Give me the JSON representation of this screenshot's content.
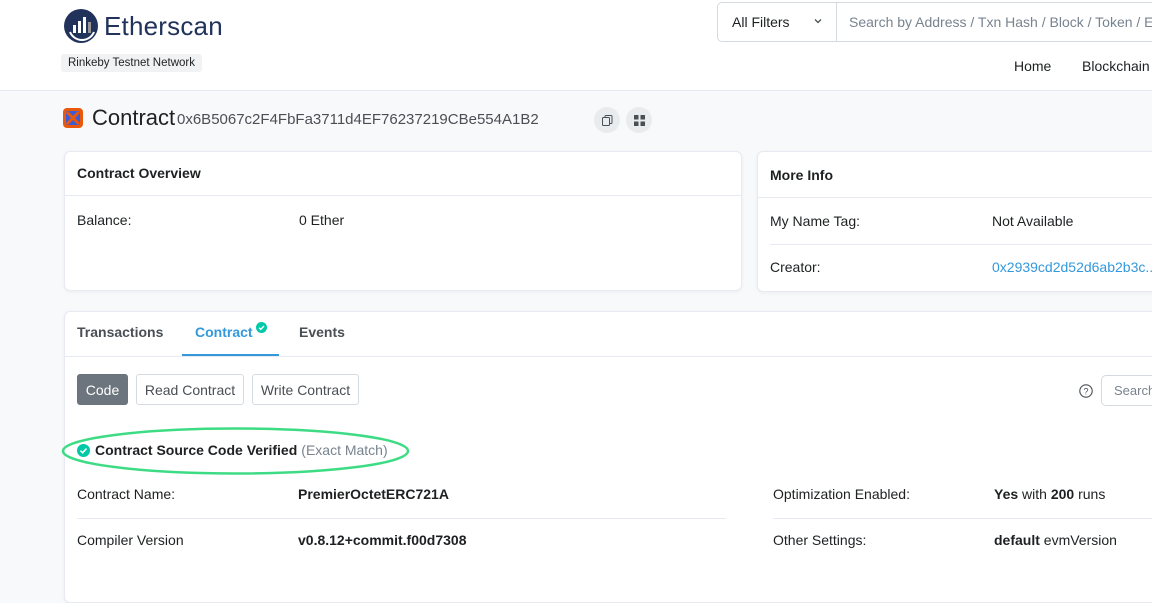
{
  "header": {
    "logo_text": "Etherscan",
    "network": "Rinkeby Testnet Network",
    "filter": "All Filters",
    "search_placeholder": "Search by Address / Txn Hash / Block / Token / Ens",
    "nav": [
      "Home",
      "Blockchain"
    ]
  },
  "title": {
    "label": "Contract",
    "address": "0x6B5067c2F4FbFa3711d4EF76237219CBe554A1B2"
  },
  "overview": {
    "heading": "Contract Overview",
    "balance_label": "Balance:",
    "balance_value": "0 Ether"
  },
  "more_info": {
    "heading": "More Info",
    "name_tag_label": "My Name Tag:",
    "name_tag_value": "Not Available",
    "creator_label": "Creator:",
    "creator_value": "0x2939cd2d52d6ab2b3c..."
  },
  "tabs": [
    {
      "label": "Transactions"
    },
    {
      "label": "Contract"
    },
    {
      "label": "Events"
    }
  ],
  "code_buttons": [
    "Code",
    "Read Contract",
    "Write Contract"
  ],
  "code_search_placeholder": "Search",
  "verified": {
    "text": "Contract Source Code Verified",
    "match": "(Exact Match)"
  },
  "details": {
    "contract_name_label": "Contract Name:",
    "contract_name_value": "PremierOctetERC721A",
    "compiler_label": "Compiler Version",
    "compiler_value": "v0.8.12+commit.f00d7308",
    "optimization_label": "Optimization Enabled:",
    "optimization_yes": "Yes",
    "optimization_with": "with",
    "optimization_runs": "200",
    "optimization_runs_label": "runs",
    "other_settings_label": "Other Settings:",
    "other_settings_default": "default",
    "other_settings_rest": "evmVersion"
  },
  "colors": {
    "accent": "#3498db",
    "verified_green": "#00c9a7",
    "highlight_ellipse": "#3ddc84"
  }
}
